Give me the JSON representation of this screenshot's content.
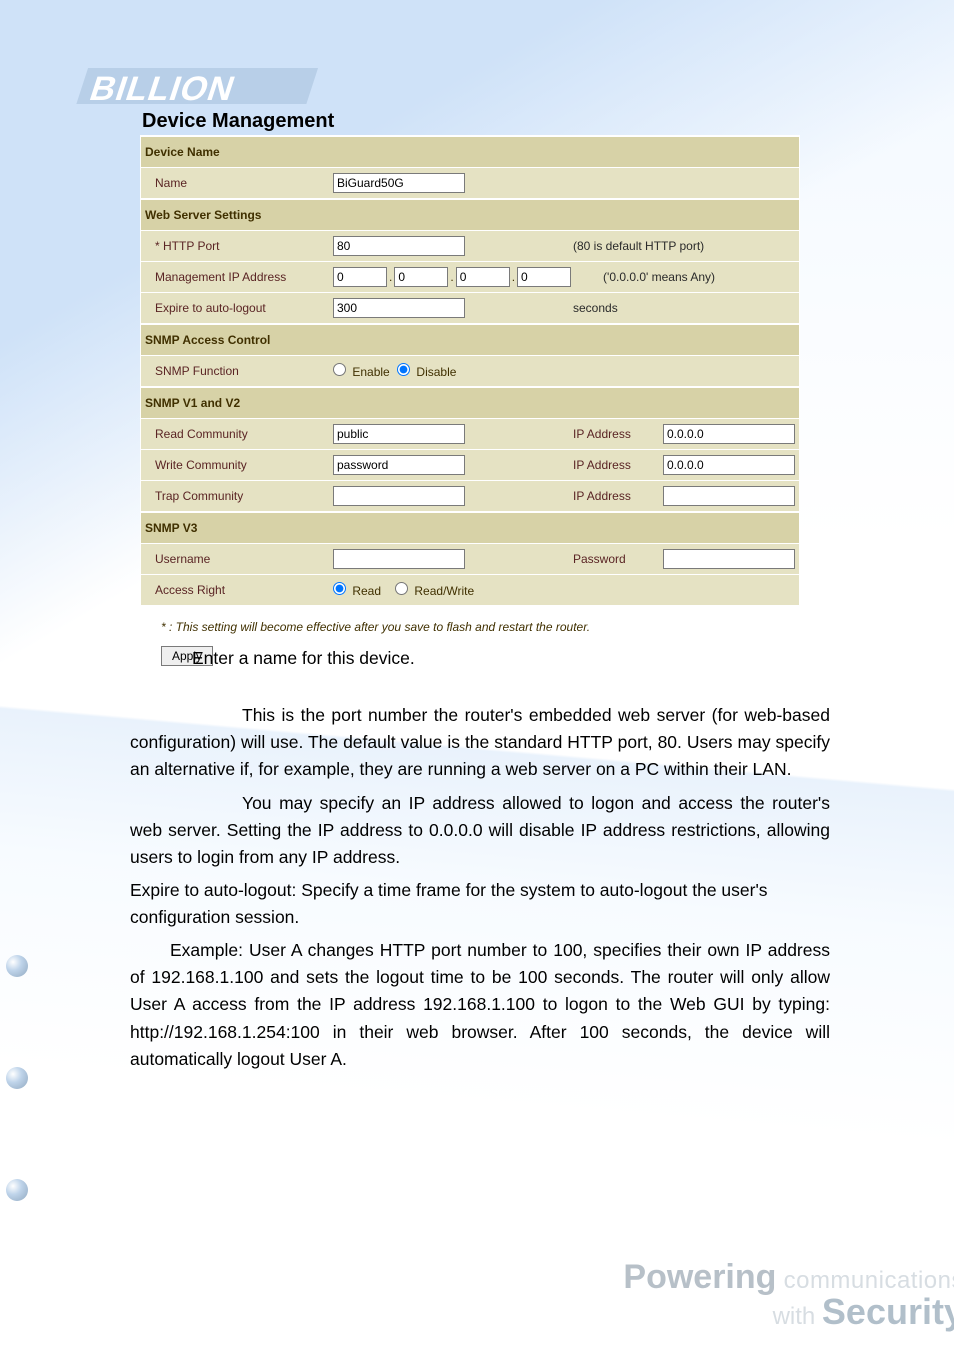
{
  "brand": "BILLION",
  "panel": {
    "title": "Device Management",
    "apply_label": "Apply",
    "footnote": "* : This setting will become effective after you save to flash and restart the router."
  },
  "sections": {
    "device_name": {
      "header": "Device Name",
      "name_label": "Name",
      "name_value": "BiGuard50G"
    },
    "web_server": {
      "header": "Web Server Settings",
      "http_port_label": "* HTTP Port",
      "http_port_value": "80",
      "http_port_hint": "(80 is default HTTP port)",
      "mgmt_ip_label": "Management IP Address",
      "mgmt_ip": [
        "0",
        "0",
        "0",
        "0"
      ],
      "mgmt_ip_hint": "('0.0.0.0' means Any)",
      "expire_label": "Expire to auto-logout",
      "expire_value": "300",
      "expire_hint": "seconds"
    },
    "snmp_access": {
      "header": "SNMP Access Control",
      "func_label": "SNMP Function",
      "enable_label": "Enable",
      "disable_label": "Disable"
    },
    "snmp12": {
      "header": "SNMP V1 and V2",
      "read_label": "Read Community",
      "read_value": "public",
      "write_label": "Write Community",
      "write_value": "password",
      "trap_label": "Trap Community",
      "trap_value": "",
      "ipaddr_label": "IP Address",
      "read_ip": "0.0.0.0",
      "write_ip": "0.0.0.0",
      "trap_ip": ""
    },
    "snmp3": {
      "header": "SNMP V3",
      "user_label": "Username",
      "user_value": "",
      "pass_label": "Password",
      "pass_value": "",
      "access_label": "Access Right",
      "read_label": "Read",
      "rw_label": "Read/Write"
    }
  },
  "doc": {
    "p1_html": "Enter a name for this device.",
    "p2_html": "This is the port number the router's embedded web server (for web-based configuration) will use. The default value is the standard HTTP port, 80. Users may specify an alternative if, for example, they are running a web server on a PC within their LAN.",
    "p3_html": "You may specify an IP address allowed to logon and access the router's web server. Setting the IP address to 0.0.0.0 will disable IP address restrictions, allowing users to login from any IP address.",
    "p4_html": "Expire to auto-logout: Specify a time frame for the system to auto-logout the user's configuration session.",
    "p5_html": "Example: User A changes HTTP port number to 100, specifies their own IP address of 192.168.1.100 and sets the logout time to be 100 seconds. The router will only allow User A access from the IP address 192.168.1.100 to logon to the Web GUI by typing: http://192.168.1.254:100 in their web browser. After 100 seconds, the device will automatically logout User A."
  },
  "footer": {
    "l1a": "Powering",
    "l1b": " communications",
    "l2a": "with ",
    "l2b": "Security"
  }
}
